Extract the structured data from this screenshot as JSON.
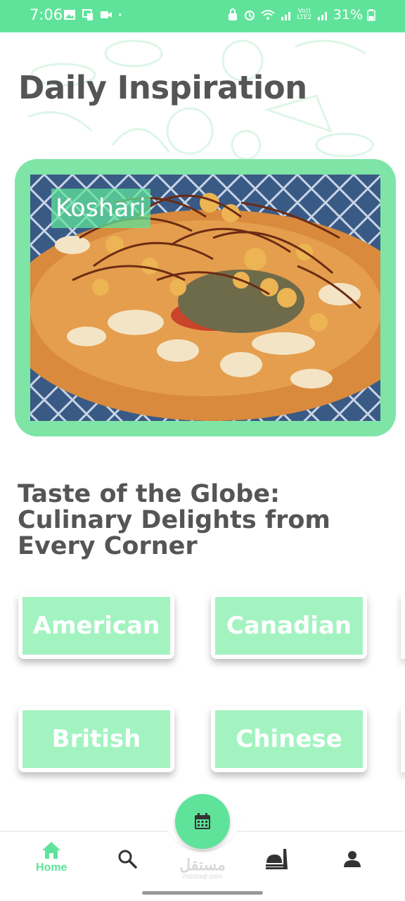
{
  "status_bar": {
    "time": "7:06",
    "battery": "31%",
    "network_label_top": "Vo))",
    "network_label_bottom": "LTE2"
  },
  "page": {
    "title": "Daily Inspiration"
  },
  "inspiration": {
    "dish_name": "Koshari"
  },
  "section": {
    "subtitle": "Taste of the Globe: Culinary Delights from Every Corner"
  },
  "cuisines": [
    {
      "label": "American"
    },
    {
      "label": "Canadian"
    },
    {
      "label": "British"
    },
    {
      "label": "Chinese"
    }
  ],
  "nav": {
    "home_label": "Home",
    "icons": [
      "home-icon",
      "search-icon",
      "calendar-icon",
      "food-icon",
      "profile-icon"
    ]
  },
  "watermark": {
    "brand": "مستقل",
    "site": "mostaql.com"
  },
  "colors": {
    "accent": "#5fe39a",
    "card_bg": "#7ee5a6",
    "tile_bg": "#a3f3c1",
    "heading": "#555555"
  }
}
